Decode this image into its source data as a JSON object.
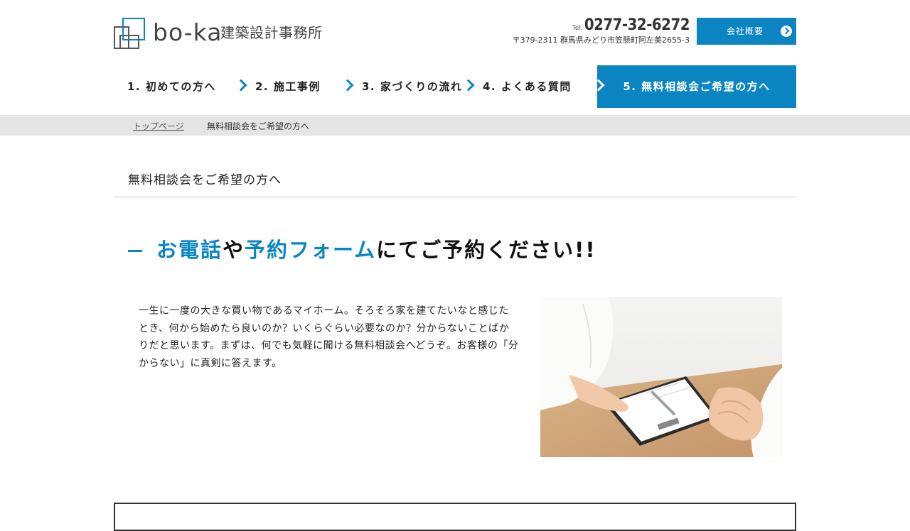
{
  "header": {
    "logo_roman": "bo-ka",
    "logo_jp": "建築設計事務所",
    "tel_prefix": "Tel.",
    "tel_number": "0277-32-6272",
    "address": "〒379-2311 群馬県みどり市笠懸町阿左美2655-3",
    "company_button": "会社概要"
  },
  "nav": {
    "items": [
      {
        "label": "1. 初めての方へ"
      },
      {
        "label": "2. 施工事例"
      },
      {
        "label": "3. 家づくりの流れ"
      },
      {
        "label": "4. よくある質問"
      },
      {
        "label": "5. 無料相談会ご希望の方へ",
        "active": true
      }
    ]
  },
  "breadcrumb": {
    "home": "トップページ",
    "current": "無料相談会をご希望の方へ"
  },
  "page": {
    "title": "無料相談会をご希望の方へ",
    "headline": {
      "part1": "お電話",
      "part2": "や",
      "part3": "予約フォーム",
      "part4": "にてご予約ください!!"
    },
    "intro": "一生に一度の大きな買い物であるマイホーム。そろそろ家を建てたいなと感じたとき、何から始めたら良いのか？いくらぐらい必要なのか？分からないことばかりだと思います。まずは、何でも気軽に聞ける無料相談会へどうぞ。お客様の「分からない」に真剣に答えます。"
  },
  "colors": {
    "accent": "#0a85c2",
    "breadcrumb_bg": "#e5e5e5"
  },
  "icons": [
    "logo-mark-icon",
    "chevron-right-icon",
    "circle-chevron-icon"
  ]
}
